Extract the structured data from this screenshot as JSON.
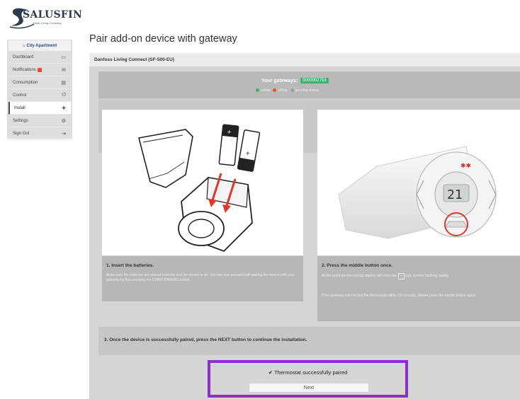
{
  "brand": {
    "name": "SALUSFIN",
    "tagline": "Smart Living Company"
  },
  "sidebar": {
    "location": "City Apartment",
    "items": [
      {
        "label": "Dashboard",
        "icon": "monitor-icon"
      },
      {
        "label": "Notifications",
        "icon": "envelope-icon",
        "badge": true
      },
      {
        "label": "Consumption",
        "icon": "chart-icon"
      },
      {
        "label": "Control",
        "icon": "power-icon"
      },
      {
        "label": "Install",
        "icon": "plus-icon",
        "active": true
      },
      {
        "label": "Settings",
        "icon": "gear-icon"
      },
      {
        "label": "Sign Out",
        "icon": "sign-out-icon"
      }
    ]
  },
  "page": {
    "title": "Pair add-on device with gateway"
  },
  "device": {
    "name": "Danfoss Living Connect (SF-500-EU)"
  },
  "gateways": {
    "label": "Your gateways:",
    "id": "0000002753",
    "legend": [
      {
        "label": "online",
        "color": "#3cb371"
      },
      {
        "label": "offline",
        "color": "#e74c3c"
      },
      {
        "label": "pending status",
        "color": "#9e9e9e"
      }
    ]
  },
  "steps": {
    "step1": {
      "title": "1. Insert the batteries.",
      "text": "Make sure the batteries are placed correctly and the device is on. You can now proceed with pairing the device with your gateway by first pressing the START PAIRING button."
    },
    "step2": {
      "title": "2. Press the middle button once.",
      "text1_pre": "At this point the thermostat display will show the",
      "text1_post": "sign symbol flashing rapidly.",
      "text2": "If the gateway can not find the thermostat within 10 seconds, please press the middle button again.",
      "display_value": "21"
    },
    "step3": {
      "text": "3. Once the device is successfully paired, press the NEXT button to continue the installation."
    }
  },
  "paired": {
    "message": "Thermostat successfully paired",
    "next_label": "Next"
  },
  "colors": {
    "highlight": "#8b2fc9",
    "gateway_badge": "#3cb371"
  }
}
